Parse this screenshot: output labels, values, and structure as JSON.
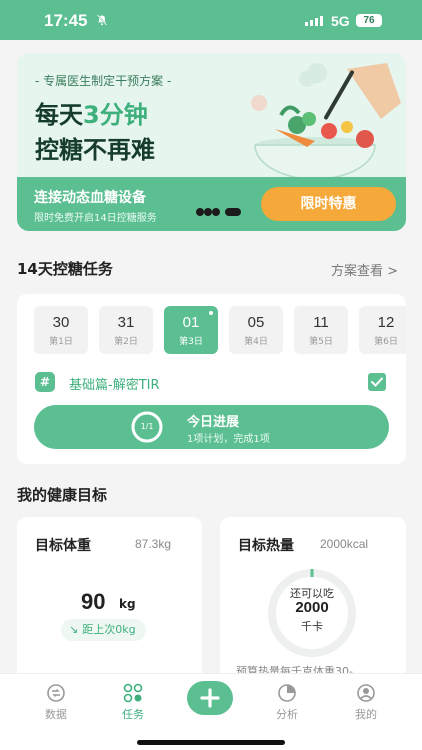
{
  "status": {
    "time": "17:45",
    "network": "5G",
    "battery": "76"
  },
  "banner": {
    "subtitle": "- 专属医生制定干预方案 -",
    "headline_pre": "每天",
    "headline_hl": "3分钟",
    "headline2": "控糖不再难",
    "strip_title": "连接动态血糖设备",
    "strip_sub": "限时免费开启14日控糖服务",
    "cta": "限时特惠"
  },
  "tasks": {
    "title": "14天控糖任务",
    "link": "方案查看 >",
    "days": [
      {
        "num": "30",
        "label": "第1日"
      },
      {
        "num": "31",
        "label": "第2日"
      },
      {
        "num": "01",
        "label": "第3日",
        "active": true
      },
      {
        "num": "05",
        "label": "第4日"
      },
      {
        "num": "11",
        "label": "第5日"
      },
      {
        "num": "12",
        "label": "第6日"
      }
    ],
    "topic_icon": "#",
    "topic": "基础篇-解密TIR",
    "progress": {
      "ring": "1/1",
      "title": "今日进展",
      "sub": "1项计划，完成1项",
      "fraction": 1.0
    }
  },
  "goals": {
    "title": "我的健康目标",
    "weight": {
      "title": "目标体重",
      "current": "87.3kg",
      "target": "90",
      "unit": "kg",
      "delta": "距上次0kg"
    },
    "calorie": {
      "title": "目标热量",
      "value": "2000kcal",
      "l1": "还可以吃",
      "l2": "2000",
      "l3": "千卡",
      "note": "预算热量每千克体重30-",
      "fraction": 0.0
    }
  },
  "tabbar": {
    "items": [
      {
        "label": "数据",
        "icon": "data-icon"
      },
      {
        "label": "任务",
        "icon": "task-icon",
        "active": true
      },
      {
        "label": "",
        "icon": "plus-icon"
      },
      {
        "label": "分析",
        "icon": "analysis-icon"
      },
      {
        "label": "我的",
        "icon": "profile-icon"
      }
    ]
  },
  "colors": {
    "accent": "#5bbf92",
    "accent_dark": "#3db07c",
    "cta": "#f5a93a"
  }
}
